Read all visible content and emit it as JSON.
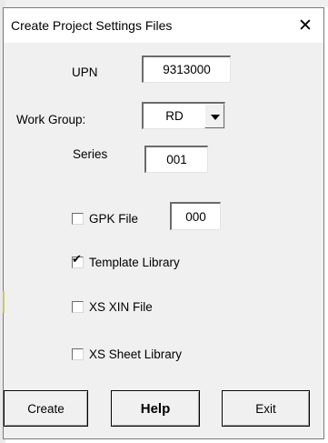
{
  "window": {
    "title": "Create Project Settings Files",
    "close_glyph": "✕"
  },
  "upn": {
    "label": "UPN",
    "value": "9313000"
  },
  "work_group": {
    "label": "Work Group:",
    "value": "RD"
  },
  "series": {
    "label": "Series",
    "value": "001"
  },
  "checkboxes": [
    {
      "label": "GPK File",
      "checked": false
    },
    {
      "label": "Template Library",
      "checked": true
    },
    {
      "label": "XS XIN File",
      "checked": false
    },
    {
      "label": "XS Sheet Library",
      "checked": false
    }
  ],
  "gpk_value": "000",
  "buttons": {
    "create": "Create",
    "help": "Help",
    "exit": "Exit"
  },
  "check_glyph": "✔",
  "colors": {
    "dialog_bg": "#f0f0f0",
    "field_bg": "#ffffff"
  }
}
